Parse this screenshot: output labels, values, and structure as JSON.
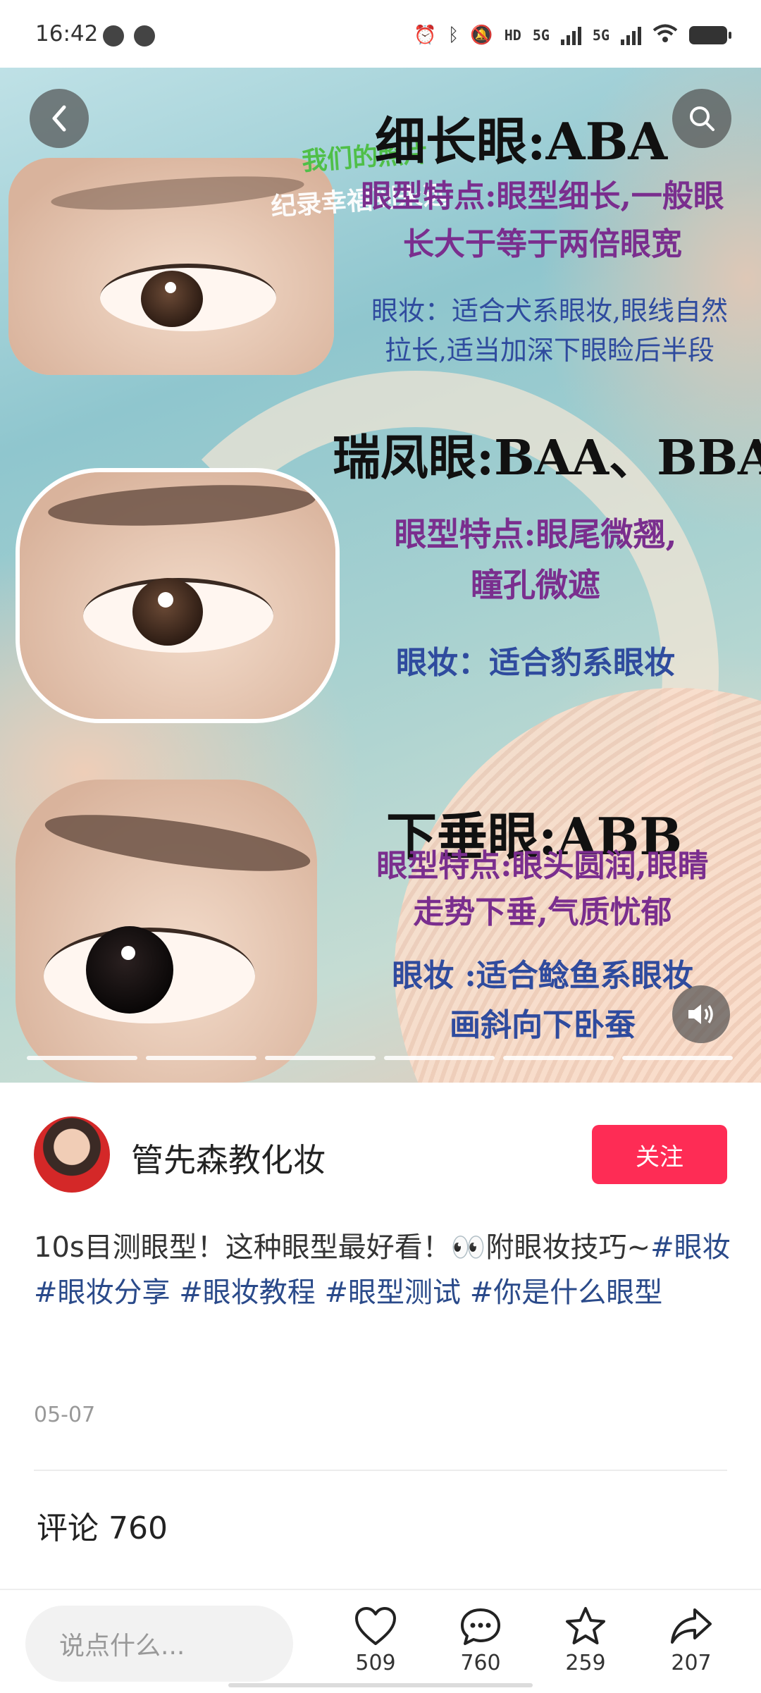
{
  "status_bar": {
    "time": "16:42",
    "network_tag": "HD",
    "net1": "5G",
    "net2": "5G",
    "icons": [
      "alarm-icon",
      "bluetooth-icon",
      "mute-icon",
      "hd-icon",
      "signal-icon",
      "signal-icon",
      "wifi-icon",
      "battery-icon"
    ]
  },
  "post_image": {
    "watermark_line1": "我们的照片",
    "watermark_line2": "纪录幸福到永远",
    "section1": {
      "title": "细长眼:ABA",
      "feature_line1": "眼型特点:眼型细长,一般眼",
      "feature_line2": "长大于等于两倍眼宽",
      "makeup_line1": "眼妆：适合犬系眼妆,眼线自然",
      "makeup_line2": "拉长,适当加深下眼睑后半段"
    },
    "section2": {
      "title": "瑞凤眼:BAA、BBA",
      "feature_line1": "眼型特点:眼尾微翘,",
      "feature_line2": "瞳孔微遮",
      "makeup_line1": "眼妆：适合豹系眼妆"
    },
    "section3": {
      "title": "下垂眼:ABB",
      "feature_line1": "眼型特点:眼头圆润,眼睛",
      "feature_line2": "走势下垂,气质忧郁",
      "makeup_line1": "眼妆 :适合鲶鱼系眼妆",
      "makeup_line2": "画斜向下卧蚕"
    },
    "slide_count": 6
  },
  "author": {
    "name": "管先森教化妆",
    "follow_label": "关注"
  },
  "description": {
    "text": "10s目测眼型！这种眼型最好看！👀附眼妆技巧~",
    "tags": [
      "#眼妆",
      "#眼妆分享",
      "#眼妆教程",
      "#眼型测试",
      "#你是什么眼型"
    ]
  },
  "date": "05-07",
  "comments_header": "评论 760",
  "bottom_bar": {
    "input_placeholder": "说点什么...",
    "likes": "509",
    "comments": "760",
    "favorites": "259",
    "shares": "207"
  }
}
